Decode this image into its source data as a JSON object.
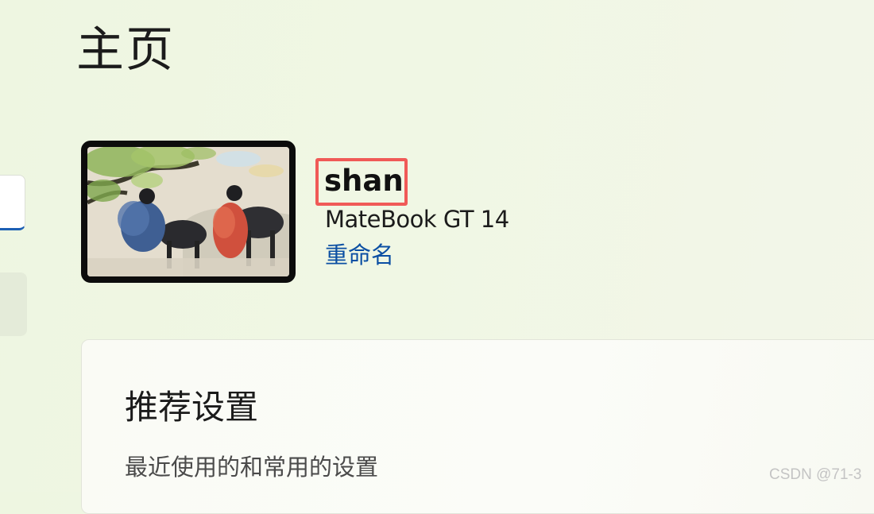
{
  "page": {
    "title": "主页"
  },
  "sidebar": {
    "search_icon": "search-icon"
  },
  "device": {
    "name": "shan",
    "model": "MateBook GT 14",
    "rename_label": "重命名",
    "highlight_color": "#f05a57",
    "link_color": "#0b4fa3"
  },
  "recommended": {
    "title": "推荐设置",
    "subtitle": "最近使用的和常用的设置"
  },
  "watermark": {
    "text": "CSDN @71-3"
  }
}
